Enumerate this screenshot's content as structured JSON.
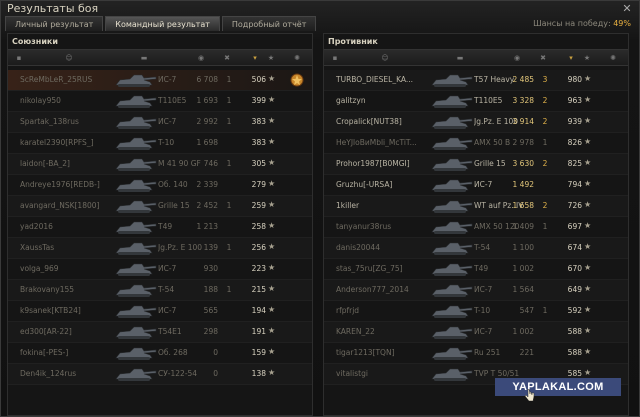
{
  "window": {
    "title": "Результаты боя"
  },
  "tabs": [
    {
      "label": "Личный результат",
      "active": false
    },
    {
      "label": "Командный результат",
      "active": true
    },
    {
      "label": "Подробный отчёт",
      "active": false
    }
  ],
  "chance": {
    "label": "Шансы на победу:",
    "value": "49%"
  },
  "allies": {
    "title": "Союзники",
    "rows": [
      {
        "player": "ScReMbLeR_25RUS",
        "tank": "ИС-7",
        "damage": "6 708",
        "kills": "1",
        "xp": "506",
        "medal": true,
        "me": true,
        "dead": true
      },
      {
        "player": "nikolay950",
        "tank": "T110E5",
        "damage": "1 693",
        "kills": "1",
        "xp": "399",
        "dead": true
      },
      {
        "player": "Spartak_138rus",
        "tank": "ИС-7",
        "damage": "2 992",
        "kills": "1",
        "xp": "383",
        "dead": true
      },
      {
        "player": "karatel2390[RPFS_]",
        "tank": "T-10",
        "damage": "1 698",
        "kills": "",
        "xp": "383",
        "dead": true
      },
      {
        "player": "laidon[-BA_2]",
        "tank": "M 41 90 GF",
        "damage": "746",
        "kills": "1",
        "xp": "305",
        "dead": true
      },
      {
        "player": "Andreye1976[REDB-]",
        "tank": "Об. 140",
        "damage": "2 339",
        "kills": "",
        "xp": "279",
        "dead": true
      },
      {
        "player": "avangard_NSK[1800]",
        "tank": "Grille 15",
        "damage": "2 452",
        "kills": "1",
        "xp": "259",
        "dead": true
      },
      {
        "player": "yad2016",
        "tank": "T49",
        "damage": "1 213",
        "kills": "",
        "xp": "258",
        "dead": true
      },
      {
        "player": "XaussTas",
        "tank": "Jg.Pz. E 100",
        "damage": "139",
        "kills": "1",
        "xp": "256",
        "dead": true
      },
      {
        "player": "volga_969",
        "tank": "ИС-7",
        "damage": "930",
        "kills": "",
        "xp": "223",
        "dead": true
      },
      {
        "player": "Brakovany155",
        "tank": "T-54",
        "damage": "188",
        "kills": "1",
        "xp": "215",
        "dead": true
      },
      {
        "player": "k9sanek[KTB24]",
        "tank": "ИС-7",
        "damage": "565",
        "kills": "",
        "xp": "194",
        "dead": true
      },
      {
        "player": "ed300[AR-22]",
        "tank": "T54E1",
        "damage": "298",
        "kills": "",
        "xp": "191",
        "dead": true
      },
      {
        "player": "fokina[-PES-]",
        "tank": "Об. 268",
        "damage": "0",
        "kills": "",
        "xp": "159",
        "dead": true
      },
      {
        "player": "Den4ik_124rus",
        "tank": "СУ-122-54",
        "damage": "0",
        "kills": "",
        "xp": "138",
        "dead": true
      }
    ]
  },
  "enemies": {
    "title": "Противник",
    "rows": [
      {
        "player": "TURBO_DIESEL_KA...",
        "tank": "T57 Heavy",
        "damage": "2 485",
        "kills": "3",
        "xp": "980"
      },
      {
        "player": "galitzyn",
        "tank": "T110E5",
        "damage": "3 328",
        "kills": "2",
        "xp": "963"
      },
      {
        "player": "Cropalick[NUT38]",
        "tank": "Jg.Pz. E 100",
        "damage": "3 914",
        "kills": "2",
        "xp": "939"
      },
      {
        "player": "HeYJloBиMbli_McTiT...",
        "tank": "AMX 50 B",
        "damage": "2 978",
        "kills": "1",
        "xp": "826",
        "dead": true
      },
      {
        "player": "Prohor1987[B0MGI]",
        "tank": "Grille 15",
        "damage": "3 630",
        "kills": "2",
        "xp": "825"
      },
      {
        "player": "Gruzhu[-URSA]",
        "tank": "ИС-7",
        "damage": "1 492",
        "kills": "",
        "xp": "794"
      },
      {
        "player": "1killer",
        "tank": "WT auf Pz. IV",
        "damage": "1 658",
        "kills": "2",
        "xp": "726"
      },
      {
        "player": "tanyanur38rus",
        "tank": "AMX 50 120",
        "damage": "1 409",
        "kills": "1",
        "xp": "697",
        "dead": true
      },
      {
        "player": "danis20044",
        "tank": "T-54",
        "damage": "1 100",
        "kills": "",
        "xp": "674",
        "dead": true
      },
      {
        "player": "stas_75ru[ZG_75]",
        "tank": "T49",
        "damage": "1 002",
        "kills": "",
        "xp": "670",
        "dead": true
      },
      {
        "player": "Anderson777_2014",
        "tank": "ИС-7",
        "damage": "1 564",
        "kills": "",
        "xp": "649",
        "dead": true
      },
      {
        "player": "rfpfrjd",
        "tank": "T-10",
        "damage": "547",
        "kills": "1",
        "xp": "592",
        "dead": true
      },
      {
        "player": "KAREN_22",
        "tank": "ИС-7",
        "damage": "1 002",
        "kills": "",
        "xp": "588",
        "dead": true
      },
      {
        "player": "tigar1213[TQN]",
        "tank": "Ru 251",
        "damage": "221",
        "kills": "",
        "xp": "588",
        "dead": true
      },
      {
        "player": "vitalistgi",
        "tank": "TVP T 50/51",
        "damage": "",
        "kills": "",
        "xp": "585",
        "dead": true
      }
    ]
  },
  "watermark": "YAPLAKAL.COM",
  "colors": {
    "accent": "#e8b040",
    "background": "#121212"
  }
}
